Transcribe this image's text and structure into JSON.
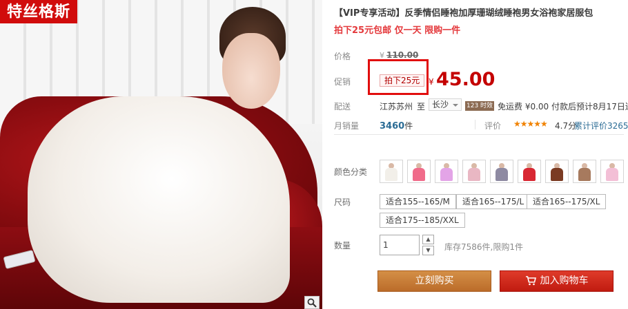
{
  "gallery": {
    "brand": "特丝格斯",
    "zoom_icon": "magnifier-icon"
  },
  "product": {
    "title": "【VIP专享活动】反季情侣睡袍加厚珊瑚绒睡袍男女浴袍家居服包",
    "subtitle": "拍下25元包邮 仅一天 限购一件"
  },
  "price": {
    "label": "价格",
    "currency": "¥",
    "original": "110.00"
  },
  "promo": {
    "label": "促销",
    "tag": "拍下25元",
    "currency": "¥",
    "price": "45.00",
    "highlight_color": "#e10d0d"
  },
  "shipping": {
    "label": "配送",
    "from": "江苏苏州",
    "to_word": "至",
    "to_city": "长沙",
    "badge": "123 时效",
    "info": "免运费 ¥0.00 付款后预计8月17日送"
  },
  "sales": {
    "label": "月销量",
    "count": "3460",
    "unit": "件",
    "rating_label": "评价",
    "stars": "★★★★★",
    "score": "4.7分",
    "reviews": "累计评价3265"
  },
  "color": {
    "label": "颜色分类",
    "swatches": [
      "#f2efe9",
      "#f06b8a",
      "#e3a4e7",
      "#e9b7c3",
      "#8e8aa2",
      "#d82732",
      "#7a3a22",
      "#a77a5e",
      "#f3bfd6"
    ]
  },
  "size": {
    "label": "尺码",
    "options": [
      "适合155--165/M",
      "适合165--175/L",
      "适合165--175/XL",
      "适合175--185/XXL"
    ]
  },
  "quantity": {
    "label": "数量",
    "value": "1",
    "stock": "库存7586件,限购1件"
  },
  "actions": {
    "buy": "立刻购买",
    "cart": "加入购物车"
  }
}
